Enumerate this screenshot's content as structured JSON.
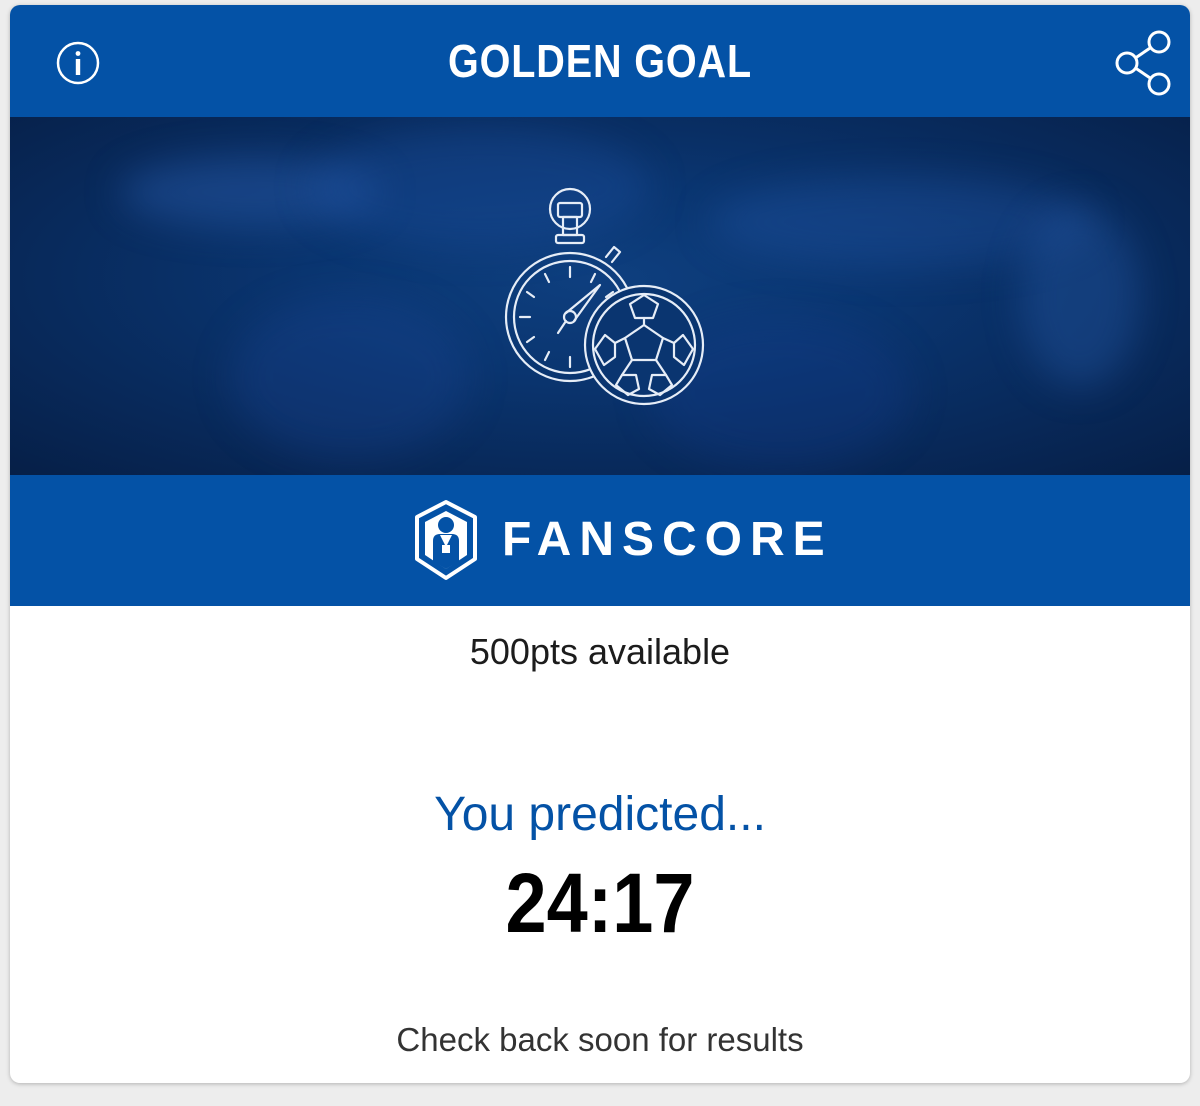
{
  "header": {
    "title": "GOLDEN GOAL",
    "info_icon": "info-circle-icon",
    "share_icon": "share-icon"
  },
  "hero": {
    "icon": "stopwatch-football-icon"
  },
  "brand": {
    "name": "FANSCORE",
    "logo_icon": "fanscore-shield-logo"
  },
  "content": {
    "points_text": "500pts available",
    "predicted_label": "You predicted...",
    "predicted_value": "24:17",
    "results_note": "Check back soon for results"
  },
  "colors": {
    "brand_blue": "#0452a6",
    "hero_dark": "#0a3570",
    "text_dark": "#1c1c1c"
  }
}
